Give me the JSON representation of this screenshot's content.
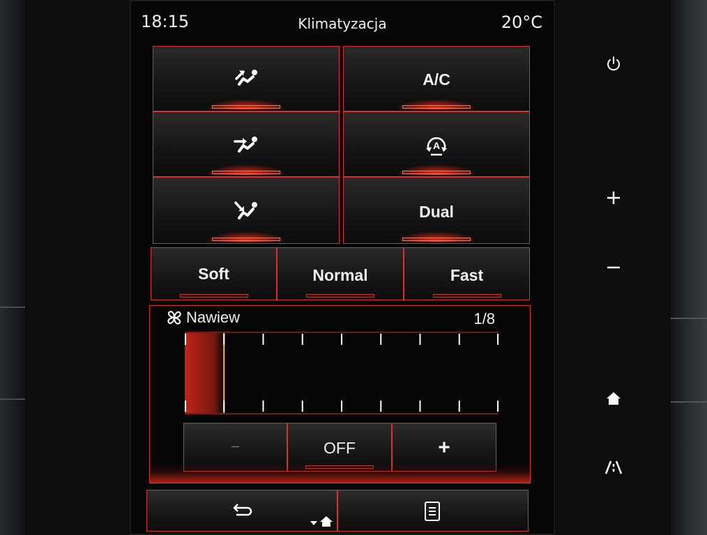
{
  "status_bar": {
    "time": "18:15",
    "title": "Klimatyzacja",
    "temperature": "20°C"
  },
  "airflow_modes": [
    {
      "name": "airflow-face",
      "icon": "airflow-face-icon",
      "active": true
    },
    {
      "name": "airflow-face-feet",
      "icon": "airflow-face-feet-icon",
      "active": true
    },
    {
      "name": "airflow-feet",
      "icon": "airflow-feet-icon",
      "active": true
    }
  ],
  "climate_options": [
    {
      "label": "A/C",
      "active": true
    },
    {
      "label": "",
      "icon": "auto-recirculation-icon",
      "active": true
    },
    {
      "label": "Dual",
      "active": true
    }
  ],
  "intensity": [
    {
      "label": "Soft"
    },
    {
      "label": "Normal"
    },
    {
      "label": "Fast"
    }
  ],
  "fan": {
    "label": "Nawiew",
    "icon": "fan-icon",
    "level_text": "1/8",
    "level": 1,
    "max": 8,
    "minus_label": "−",
    "off_label": "OFF",
    "plus_label": "+"
  },
  "bottom_nav": {
    "back_icon": "back-arrow-icon",
    "home_icon": "home-dropdown-icon",
    "menu_icon": "document-list-icon"
  },
  "side_controls": [
    "power-icon",
    "plus-icon",
    "minus-icon",
    "home-icon",
    "navigation-road-icon"
  ],
  "colors": {
    "accent": "#d8322a",
    "glow": "#ff4628",
    "text": "#f2f2f2"
  }
}
